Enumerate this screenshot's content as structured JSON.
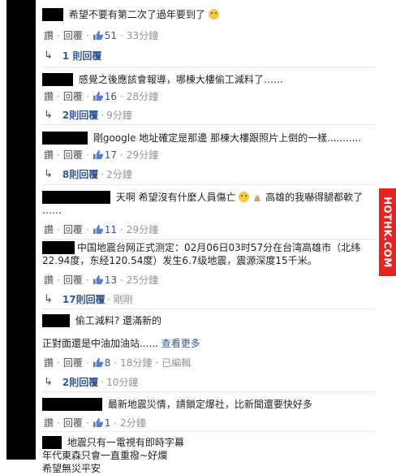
{
  "watermark": "HOTHK.COM",
  "actions": {
    "like": "讚",
    "reply": "回覆",
    "edited": "已編輯"
  },
  "comments": [
    {
      "text": "希望不要有第二次了過年要到了",
      "likes": "51",
      "time": "33分鐘",
      "reply_link": "1 則回覆",
      "reply_time": ""
    },
    {
      "text": "感覺之後應該會報導，哪棟大樓偷工減料了……",
      "likes": "16",
      "time": "28分鐘",
      "reply_link": "2則回覆",
      "reply_time": "9分鐘"
    },
    {
      "text": "剛google 地址確定是那邊 那棟大樓跟照片上倒的一樣...........",
      "likes": "17",
      "time": "29分鐘",
      "reply_link": "8則回覆",
      "reply_time": "2分鐘"
    },
    {
      "text_a": "天啊 希望沒有什麼人員傷亡",
      "text_b": "高雄的我嚇得腿都軟了",
      "text_c": "……",
      "likes": "11",
      "time": "29分鐘",
      "reply_link": "",
      "reply_time": ""
    },
    {
      "text": "中国地震台网正式测定：02月06日03时57分在台湾高雄市（北纬22.94度，东经120.54度）发生6.7级地震，震源深度15千米。",
      "likes": "13",
      "time": "25分鐘",
      "reply_link": "17則回覆",
      "reply_time": "剛剛"
    },
    {
      "text_a": "偷工減料? 還滿新的",
      "text_b": "正對面還是中油加油站......",
      "see_more": "查看更多",
      "likes": "8",
      "time": "18分鐘",
      "reply_link": "2則回覆",
      "reply_time": "10分鐘"
    },
    {
      "text": "最新地震災情，請鎖定爆社，比新聞還要快好多",
      "likes": "1",
      "time": "2分鐘"
    },
    {
      "text_a": "地震只有一電視有即時字幕",
      "text_b": "年代東森只會一直重撥~好爛",
      "text_c": "希望無災平安"
    }
  ]
}
